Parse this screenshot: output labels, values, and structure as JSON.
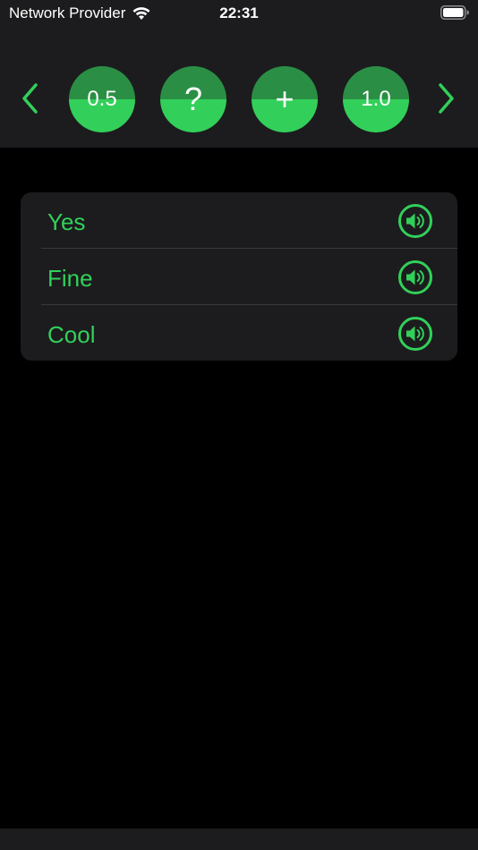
{
  "status_bar": {
    "carrier": "Network Provider",
    "time": "22:31",
    "wifi_icon": "wifi-icon",
    "battery_icon": "battery-icon"
  },
  "toolbar": {
    "prev_icon": "chevron-left-icon",
    "next_icon": "chevron-right-icon",
    "buttons": [
      {
        "label": "0.5"
      },
      {
        "label": "?"
      },
      {
        "label": "+"
      },
      {
        "label": "1.0"
      }
    ]
  },
  "list": {
    "items": [
      {
        "label": "Yes",
        "icon": "speaker-icon"
      },
      {
        "label": "Fine",
        "icon": "speaker-icon"
      },
      {
        "label": "Cool",
        "icon": "speaker-icon"
      }
    ]
  },
  "colors": {
    "accent": "#32d05a",
    "accent_dark": "#2a8f45",
    "surface": "#1c1c1e",
    "background": "#000000"
  }
}
